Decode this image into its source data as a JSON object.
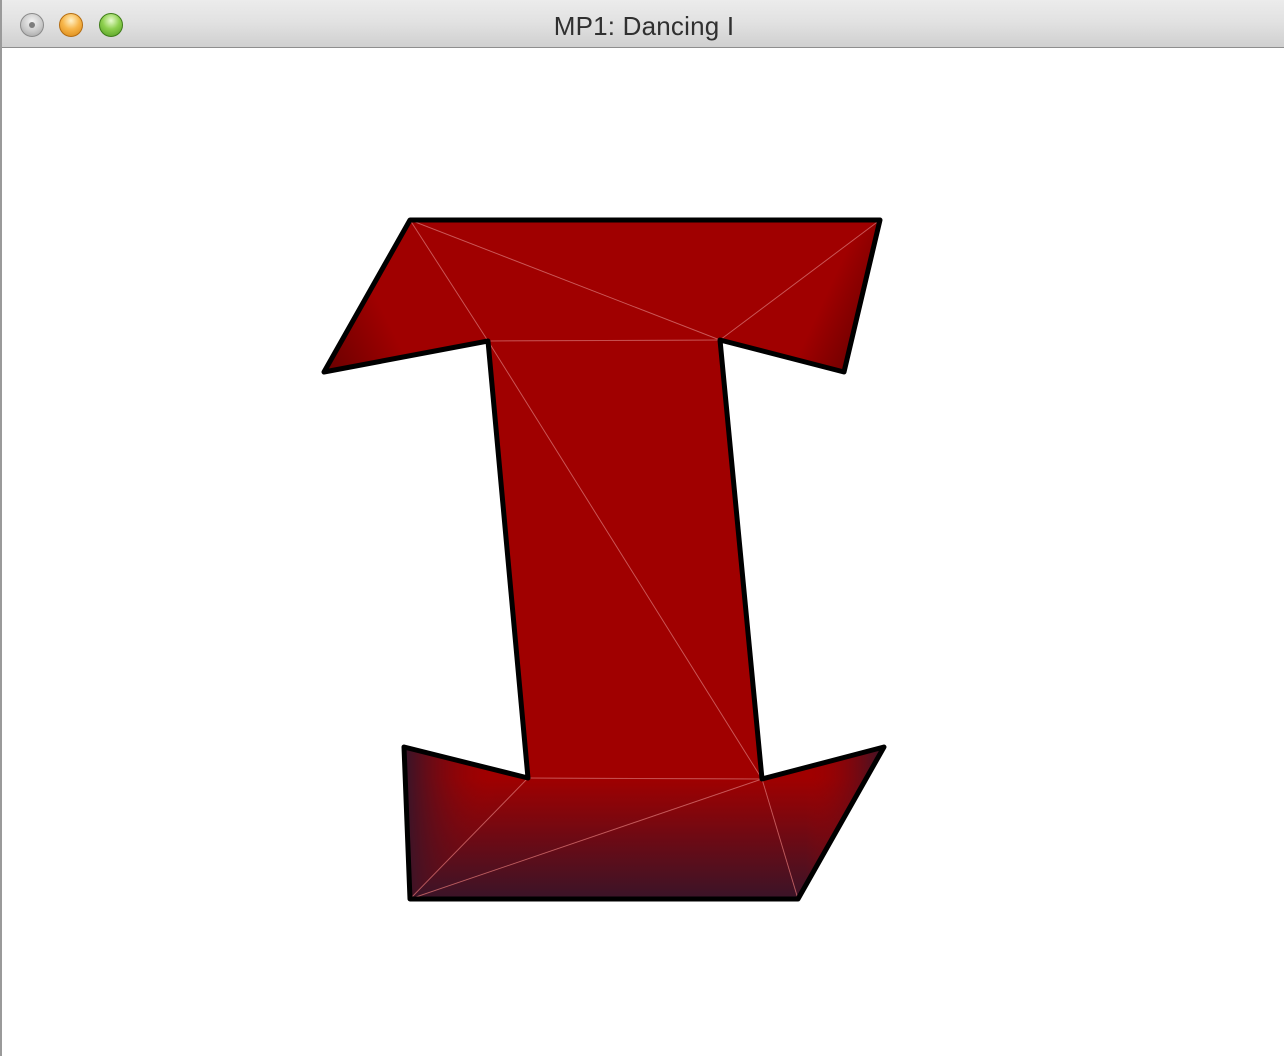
{
  "window": {
    "title": "MP1: Dancing I",
    "controls": {
      "close": "close-icon",
      "minimize": "minimize-icon",
      "zoom": "zoom-icon"
    }
  },
  "scene": {
    "shape": "letter I (triangulated mesh)",
    "colors": {
      "fill_top": "#a00000",
      "fill_dark": "#6e0000",
      "fill_bottom_dark": "#3a1428",
      "outline": "#000000",
      "mesh_lines": "#d46a6a"
    }
  }
}
